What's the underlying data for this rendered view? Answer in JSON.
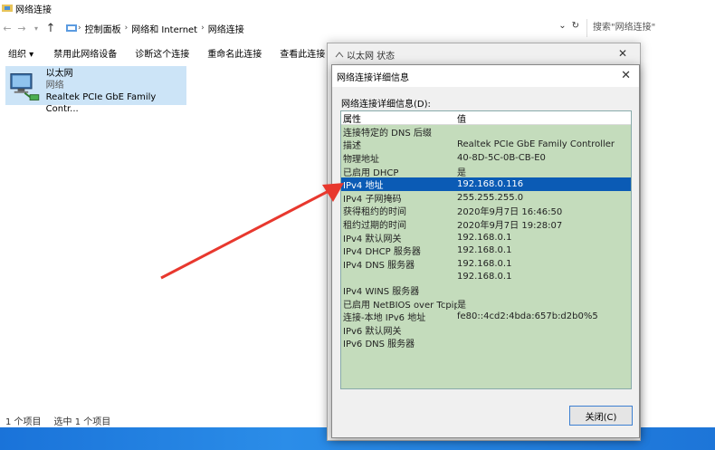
{
  "window": {
    "title": "网络连接"
  },
  "address": {
    "crumbs": [
      "控制面板",
      "网络和 Internet",
      "网络连接"
    ],
    "search_placeholder": "搜索\"网络连接\""
  },
  "toolbar": {
    "organize": "组织 ▾",
    "disable": "禁用此网络设备",
    "diagnose": "诊断这个连接",
    "rename": "重命名此连接",
    "view_status": "查看此连接"
  },
  "adapter": {
    "name": "以太网",
    "type": "网络",
    "device": "Realtek PCIe GbE Family Contr..."
  },
  "statusbar": {
    "count": "1 个项目",
    "selected": "选中 1 个项目"
  },
  "status_dialog": {
    "title": "以太网 状态"
  },
  "details_dialog": {
    "title": "网络连接详细信息",
    "label": "网络连接详细信息(D):",
    "col_property": "属性",
    "col_value": "值",
    "rows": [
      {
        "p": "连接特定的 DNS 后缀",
        "v": ""
      },
      {
        "p": "描述",
        "v": "Realtek PCIe GbE Family Controller"
      },
      {
        "p": "物理地址",
        "v": "40-8D-5C-0B-CB-E0"
      },
      {
        "p": "已启用 DHCP",
        "v": "是"
      },
      {
        "p": "IPv4 地址",
        "v": "192.168.0.116"
      },
      {
        "p": "IPv4 子网掩码",
        "v": "255.255.255.0"
      },
      {
        "p": "获得租约的时间",
        "v": "2020年9月7日 16:46:50"
      },
      {
        "p": "租约过期的时间",
        "v": "2020年9月7日 19:28:07"
      },
      {
        "p": "IPv4 默认网关",
        "v": "192.168.0.1"
      },
      {
        "p": "IPv4 DHCP 服务器",
        "v": "192.168.0.1"
      },
      {
        "p": "IPv4 DNS 服务器",
        "v": "192.168.0.1"
      },
      {
        "p": "",
        "v": "192.168.0.1"
      },
      {
        "p": "IPv4 WINS 服务器",
        "v": ""
      },
      {
        "p": "已启用 NetBIOS over Tcpip",
        "v": "是"
      },
      {
        "p": "连接-本地 IPv6 地址",
        "v": "fe80::4cd2:4bda:657b:d2b0%5"
      },
      {
        "p": "IPv6 默认网关",
        "v": ""
      },
      {
        "p": "IPv6 DNS 服务器",
        "v": ""
      }
    ],
    "close_button": "关闭(C)"
  },
  "colors": {
    "selection": "#0b5bb5",
    "list_bg": "#c4dcbc",
    "arrow": "#e8382e",
    "taskbar": "#1d75d8"
  }
}
